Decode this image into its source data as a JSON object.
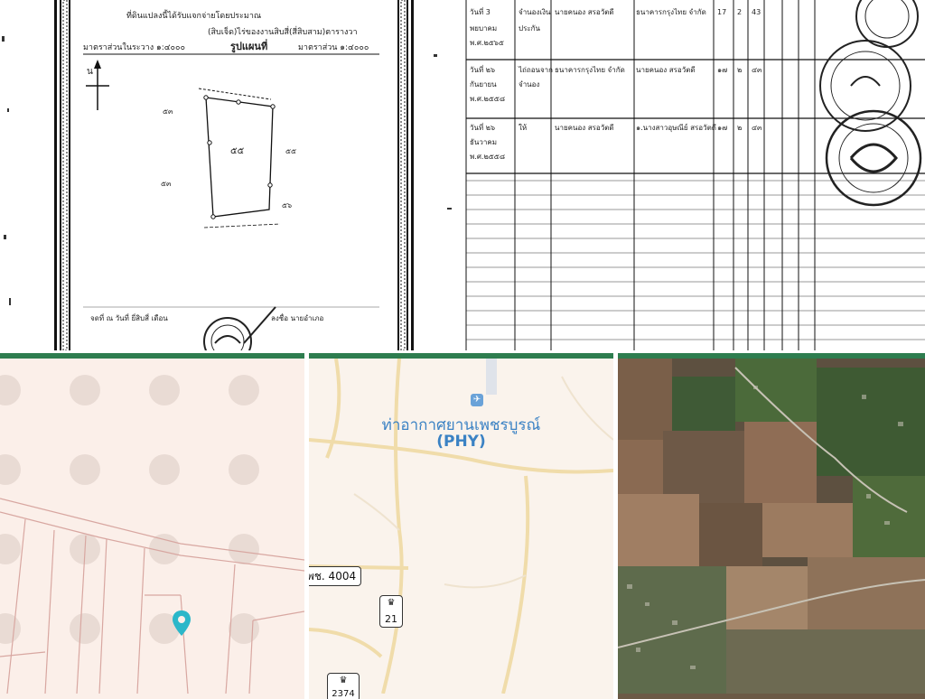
{
  "deed_front": {
    "header_line_1": "ที่ดินแปลงนี้ได้รับแจกจ่ายโดยประมาณ",
    "header_line_2": "(สิบเจ็ด)ไร่ของงานสิบสี่(สี่สิบสาม)ตารางวา",
    "scale_left": "มาตราส่วนในระวาง ๑:๔๐๐๐",
    "map_title": "รูปแผนที่",
    "scale_right": "มาตราส่วน ๑:๔๐๐๐",
    "north_arrow": "น",
    "parcel_label": "๕๕",
    "footer_text": "จดที่ ณ วันที่ ยี่สิบสี่ เดือน",
    "footer_signature": "ลงชื่อ นายอำเภอ"
  },
  "deed_register": {
    "entries": [
      {
        "date": "วันที่ 3",
        "type": "จำนองเงิน",
        "party_from": "นายคนอง สรอวัตดี",
        "party_to": "ธนาคารกรุงไทย จำกัด",
        "size": [
          "17",
          "2",
          "43"
        ]
      },
      {
        "date": "วันที่ ๒๖",
        "type": "ไถ่ถอนจาก",
        "party_from": "ธนาคารกรุงไทย จำกัด",
        "party_to": "นายคนอง สรอวัตดี",
        "size": [
          "๑๗",
          "๒",
          "๔๓"
        ]
      },
      {
        "date": "วันที่ ๒๖",
        "type": "ให้",
        "party_from": "นายคนอง สรอวัตดี",
        "party_to": "๑.นางสาวอุษณีย์ สรอวัตดี",
        "size": [
          "๑๗",
          "๒",
          "๔๓"
        ]
      }
    ]
  },
  "road_map": {
    "airport_name": "ท่าอากาศยานเพชรบูรณ์",
    "airport_code": "(PHY)",
    "road_4004": "พช. 4004",
    "road_21": "21",
    "road_2374": "2374"
  },
  "colors": {
    "divider": "#2e7d4f",
    "pin": "#2bb7c9",
    "airport_text": "#3b82c4"
  },
  "icons": {
    "location_pin": "map-pin-icon",
    "airport": "airport-icon"
  }
}
